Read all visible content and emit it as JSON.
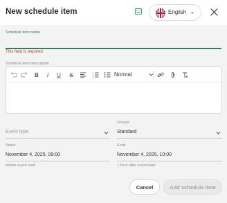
{
  "dialog": {
    "title": "New schedule item"
  },
  "header": {
    "keyboard_icon": "keyboard-icon",
    "language": {
      "label": "English",
      "flag_icon": "uk-flag-icon",
      "caret_icon": "chevron-down-icon"
    },
    "close_icon": "close-icon"
  },
  "form": {
    "name": {
      "label": "Schedule item name",
      "value": "",
      "error": "This field is required"
    },
    "description": {
      "label": "Schedule item description",
      "toolbar": {
        "undo_icon": "undo-icon",
        "redo_icon": "redo-icon",
        "bold": "B",
        "italic": "I",
        "underline": "U",
        "strikethrough": "S",
        "align_icon": "align-left-icon",
        "numbered_list_icon": "numbered-list-icon",
        "bullet_list_icon": "bullet-list-icon",
        "format_value": "Normal",
        "link_icon": "link-icon",
        "attachment_icon": "attachment-icon",
        "clear_format_icon": "clear-format-icon"
      },
      "value": ""
    },
    "event_type": {
      "label": "",
      "placeholder": "Event type",
      "value": ""
    },
    "groups": {
      "label": "Groups",
      "value": "Standard"
    },
    "starts": {
      "label": "Starts",
      "value": "November 4, 2025, 09:00",
      "helper": "before event start"
    },
    "ends": {
      "label": "Ends",
      "value": "November 4, 2025, 10:00",
      "helper": "1 hour after event start"
    }
  },
  "actions": {
    "cancel_label": "Cancel",
    "submit_label": "Add schedule item"
  },
  "colors": {
    "accent": "#2e7d64",
    "error": "#c0392b",
    "background": "#f3f3f3",
    "disabled_button": "#e9e9e9"
  }
}
